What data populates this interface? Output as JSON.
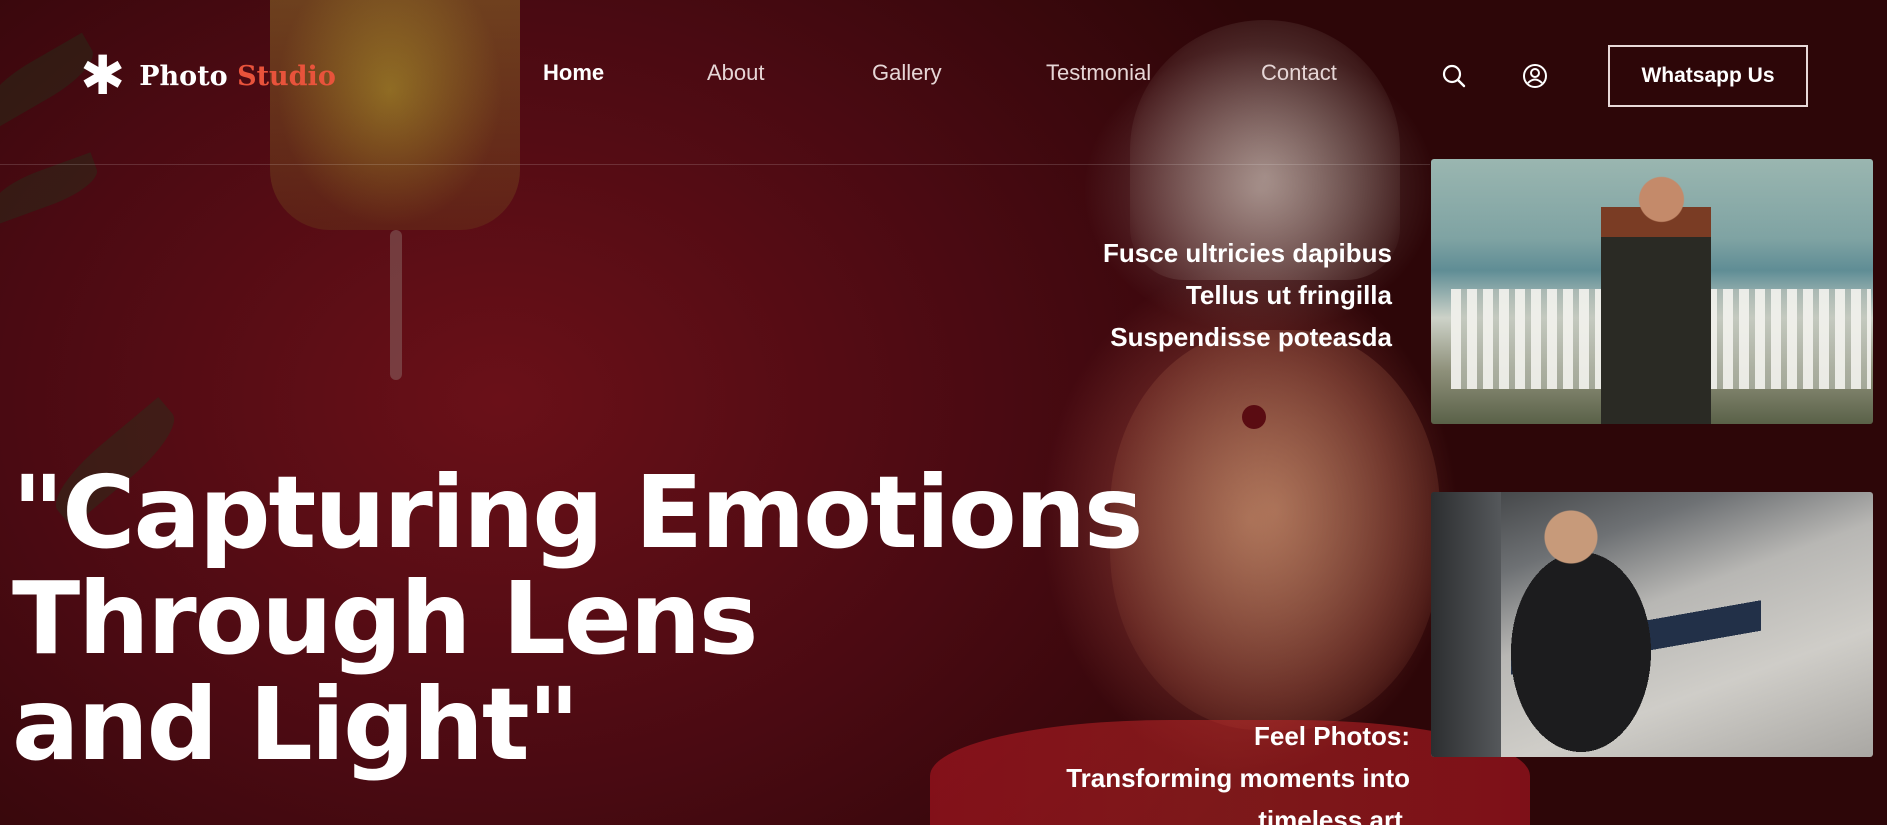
{
  "logo": {
    "text_main": "Photo ",
    "text_accent": "Studio",
    "icon": "asterisk-icon",
    "accent_color": "#e8533b"
  },
  "nav": {
    "items": [
      {
        "label": "Home",
        "active": true
      },
      {
        "label": "About",
        "active": false
      },
      {
        "label": "Gallery",
        "active": false
      },
      {
        "label": "Testmonial",
        "active": false
      },
      {
        "label": "Contact",
        "active": false
      }
    ],
    "search_icon": "search-icon",
    "account_icon": "user-circle-icon",
    "cta_label": "Whatsapp Us"
  },
  "tags": [
    "Fusce ultricies dapibus",
    "Tellus ut fringilla",
    "Suspendisse poteasda"
  ],
  "hero": {
    "lines": [
      "\"Capturing Emotions",
      "Through Lens",
      "and Light\""
    ]
  },
  "feel": {
    "lines": [
      "Feel Photos:",
      "Transforming moments into",
      "timeless art."
    ]
  },
  "colors": {
    "background": "#4a0a12",
    "text": "#ffffff"
  }
}
